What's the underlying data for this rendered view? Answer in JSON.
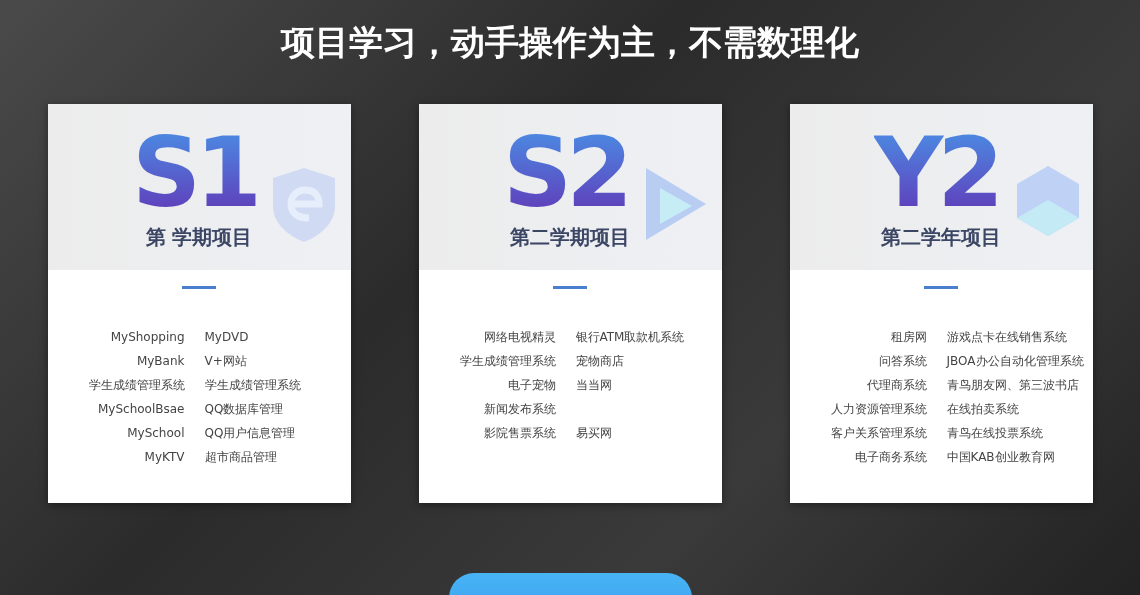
{
  "heading": "项目学习，动手操作为主，不需数理化",
  "cards": [
    {
      "badge": "S1",
      "title": "第 学期项目",
      "rows": [
        {
          "left": "MyShopping",
          "right": "MyDVD"
        },
        {
          "left": "MyBank",
          "right": "V+网站"
        },
        {
          "left": "学生成绩管理系统",
          "right": "学生成绩管理系统"
        },
        {
          "left": "MySchoolBsae",
          "right": "QQ数据库管理"
        },
        {
          "left": "MySchool",
          "right": "QQ用户信息管理"
        },
        {
          "left": "MyKTV",
          "right": "超市商品管理"
        }
      ]
    },
    {
      "badge": "S2",
      "title": "第二学期项目",
      "rows": [
        {
          "left": "网络电视精灵",
          "right": "银行ATM取款机系统"
        },
        {
          "left": "学生成绩管理系统",
          "right": "宠物商店"
        },
        {
          "left": "电子宠物",
          "right": "当当网"
        },
        {
          "left": "新闻发布系统"
        },
        {
          "left": "影院售票系统",
          "right": "易买网"
        }
      ]
    },
    {
      "badge": "Y2",
      "title": "第二学年项目",
      "rows": [
        {
          "left": "租房网",
          "right": "游戏点卡在线销售系统"
        },
        {
          "left": "问答系统",
          "right": "JBOA办公自动化管理系统"
        },
        {
          "left": "代理商系统",
          "right": "青鸟朋友网、第三波书店"
        },
        {
          "left": "人力资源管理系统",
          "right": "在线拍卖系统"
        },
        {
          "left": "客户关系管理系统",
          "right": "青鸟在线投票系统"
        },
        {
          "left": "电子商务系统",
          "right": "中国KAB创业教育网"
        }
      ]
    }
  ]
}
